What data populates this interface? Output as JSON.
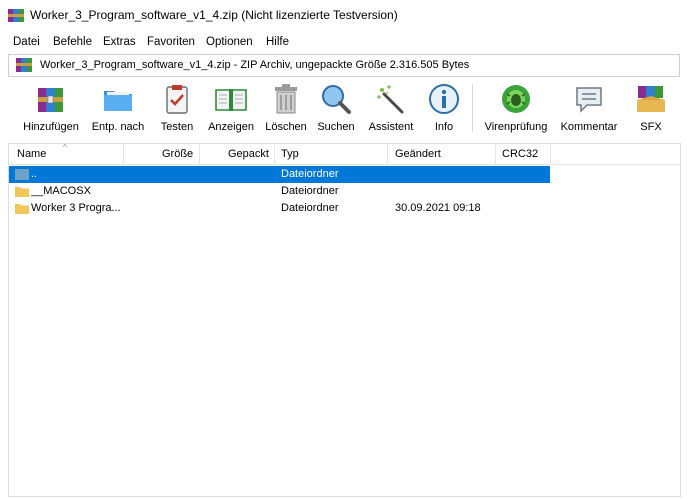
{
  "window": {
    "title": "Worker_3_Program_software_v1_4.zip (Nicht lizenzierte Testversion)"
  },
  "menu": [
    "Datei",
    "Befehle",
    "Extras",
    "Favoriten",
    "Optionen",
    "Hilfe"
  ],
  "path": {
    "text": "Worker_3_Program_software_v1_4.zip - ZIP Archiv, ungepackte Größe 2.316.505 Bytes"
  },
  "toolbar": [
    {
      "label": "Hinzufügen",
      "icon": "add-archive-icon"
    },
    {
      "label": "Entp. nach",
      "icon": "extract-folder-icon"
    },
    {
      "label": "Testen",
      "icon": "test-clipboard-icon"
    },
    {
      "label": "Anzeigen",
      "icon": "view-book-icon"
    },
    {
      "label": "Löschen",
      "icon": "trash-icon"
    },
    {
      "label": "Suchen",
      "icon": "magnifier-icon"
    },
    {
      "label": "Assistent",
      "icon": "wizard-wand-icon"
    },
    {
      "label": "Info",
      "icon": "info-icon"
    },
    {
      "label": "Virenprüfung",
      "icon": "virus-scan-icon"
    },
    {
      "label": "Kommentar",
      "icon": "comment-icon"
    },
    {
      "label": "SFX",
      "icon": "sfx-icon"
    }
  ],
  "columns": [
    "Name",
    "Größe",
    "Gepackt",
    "Typ",
    "Geändert",
    "CRC32"
  ],
  "rows": [
    {
      "name": "..",
      "size": "",
      "packed": "",
      "type": "Dateiordner",
      "modified": "",
      "crc": "",
      "selected": true
    },
    {
      "name": "__MACOSX",
      "size": "",
      "packed": "",
      "type": "Dateiordner",
      "modified": "",
      "crc": ""
    },
    {
      "name": "Worker 3 Progra...",
      "size": "",
      "packed": "",
      "type": "Dateiordner",
      "modified": "30.09.2021 09:18",
      "crc": ""
    }
  ],
  "colors": {
    "selection": "#0078d7",
    "folder": "#f0c75a"
  }
}
